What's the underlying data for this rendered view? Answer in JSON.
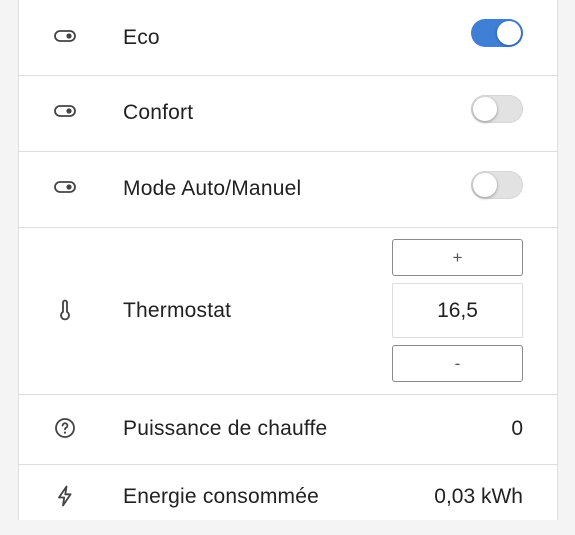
{
  "rows": [
    {
      "label": "Eco",
      "type": "toggle",
      "on": true,
      "icon": "toggle-switch-icon"
    },
    {
      "label": "Confort",
      "type": "toggle",
      "on": false,
      "icon": "toggle-switch-icon"
    },
    {
      "label": "Mode Auto/Manuel",
      "type": "toggle",
      "on": false,
      "icon": "toggle-switch-icon"
    },
    {
      "label": "Thermostat",
      "type": "number",
      "icon": "thermometer-icon",
      "increment_label": "+",
      "value": "16,5",
      "decrement_label": "-"
    },
    {
      "label": "Puissance de chauffe",
      "type": "sensor",
      "icon": "help-circle-icon",
      "value": "0"
    },
    {
      "label": "Energie consommée",
      "type": "sensor",
      "icon": "flash-icon",
      "value": "0,03 kWh"
    }
  ],
  "colors": {
    "accent": "#3f7fd6",
    "toggle_off": "#e2e2e2",
    "divider": "#dedede"
  }
}
